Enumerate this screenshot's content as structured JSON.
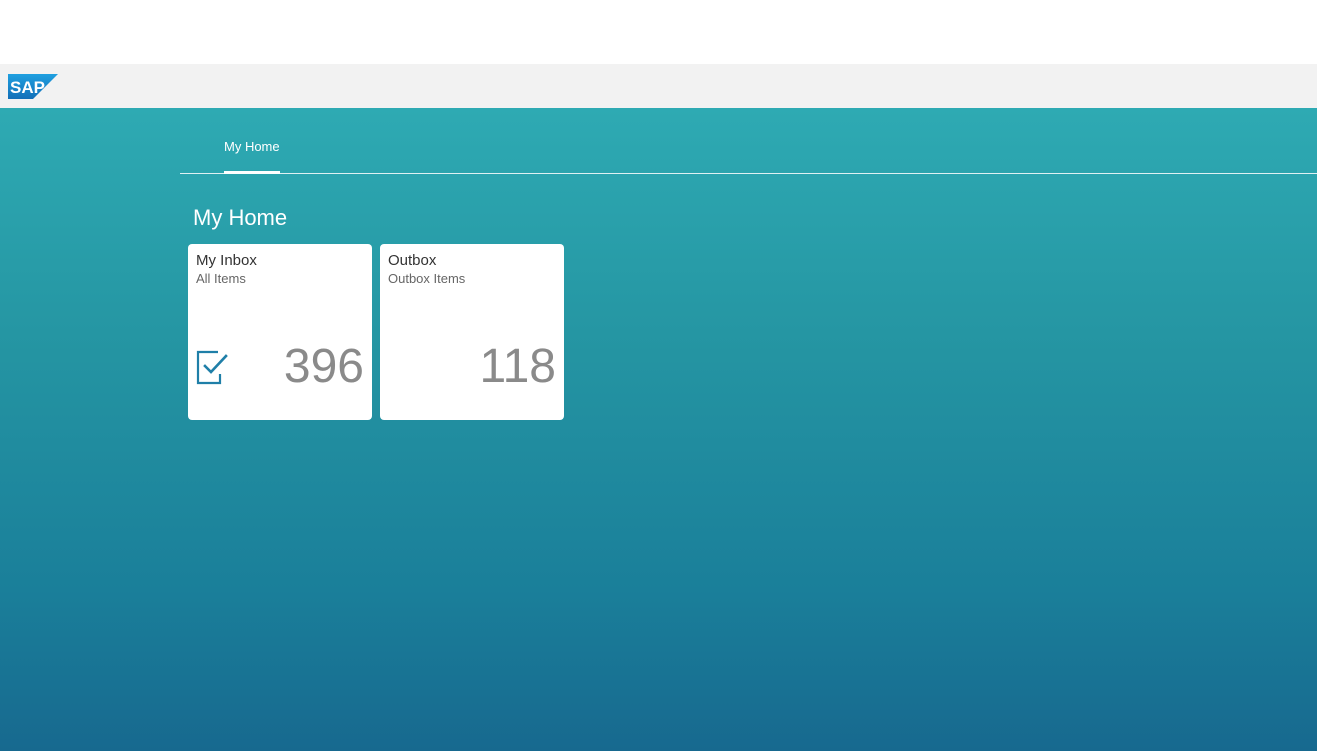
{
  "shell": {
    "logo_text": "SAP",
    "brand_color": "#1a87c9"
  },
  "tabs": [
    {
      "label": "My Home",
      "selected": true
    }
  ],
  "group": {
    "title": "My Home"
  },
  "tiles": [
    {
      "title": "My Inbox",
      "subtitle": "All Items",
      "count": "396",
      "icon": "task-check-icon"
    },
    {
      "title": "Outbox",
      "subtitle": "Outbox Items",
      "count": "118",
      "icon": ""
    }
  ]
}
